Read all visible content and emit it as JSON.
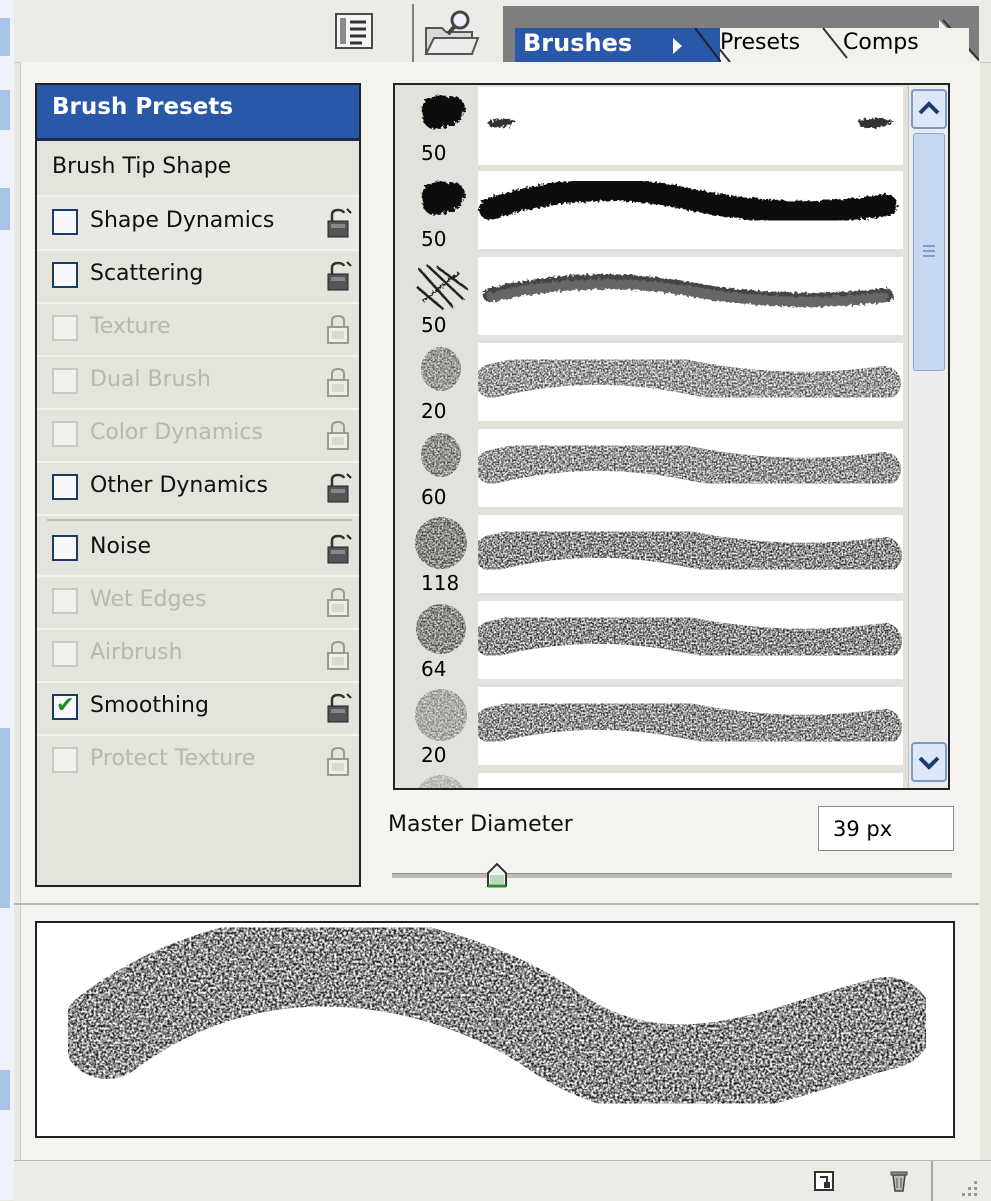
{
  "tabs": {
    "brushes": "Brushes",
    "presets": "Presets",
    "comps": "Comps"
  },
  "left_panel": {
    "header": "Brush Presets",
    "items": [
      {
        "label": "Brush Tip Shape",
        "type": "plain"
      },
      {
        "label": "Shape Dynamics",
        "checked": false,
        "enabled": true
      },
      {
        "label": "Scattering",
        "checked": false,
        "enabled": true
      },
      {
        "label": "Texture",
        "checked": false,
        "enabled": false
      },
      {
        "label": "Dual Brush",
        "checked": false,
        "enabled": false
      },
      {
        "label": "Color Dynamics",
        "checked": false,
        "enabled": false
      },
      {
        "label": "Other Dynamics",
        "checked": false,
        "enabled": true
      },
      {
        "label": "Noise",
        "checked": false,
        "enabled": true
      },
      {
        "label": "Wet Edges",
        "checked": false,
        "enabled": false
      },
      {
        "label": "Airbrush",
        "checked": false,
        "enabled": false
      },
      {
        "label": "Smoothing",
        "checked": true,
        "enabled": true
      },
      {
        "label": "Protect Texture",
        "checked": false,
        "enabled": false
      }
    ]
  },
  "brush_list": {
    "sizes": [
      "50",
      "50",
      "50",
      "20",
      "60",
      "118",
      "64",
      "20"
    ]
  },
  "master_diameter": {
    "label": "Master Diameter",
    "value": "39 px"
  },
  "icons": {
    "toolbar": [
      "document-list-icon",
      "folder-search-icon"
    ],
    "bottom": [
      "new-brush-icon",
      "trash-icon"
    ]
  },
  "colors": {
    "accent": "#2a58a8",
    "checkmark": "#1d8f22"
  }
}
